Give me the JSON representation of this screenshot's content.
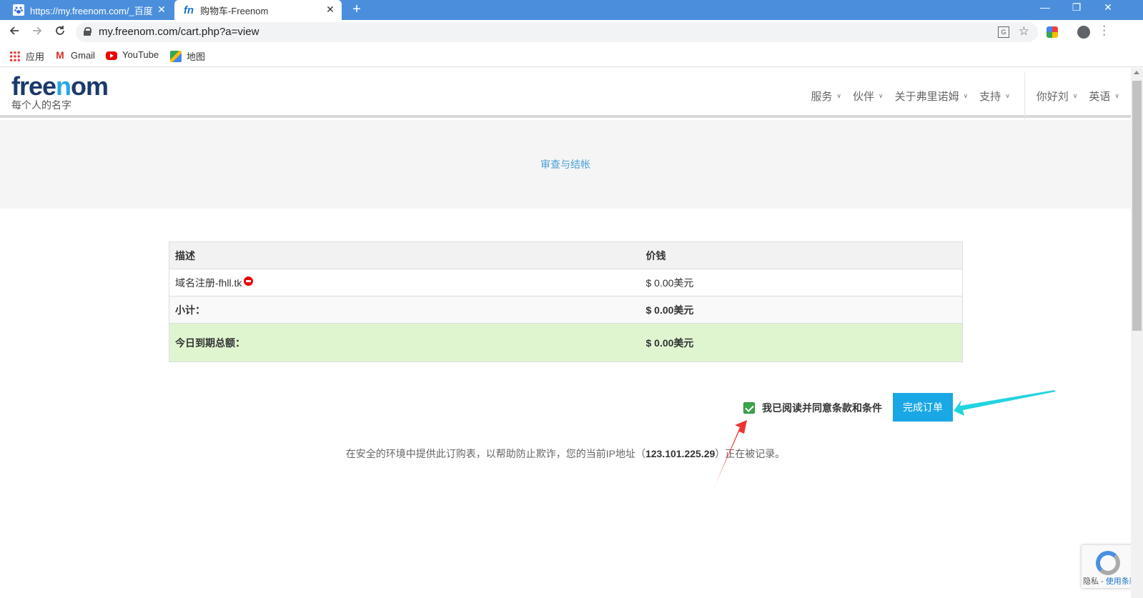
{
  "browser": {
    "tabs": [
      {
        "title": "https://my.freenom.com/_百度",
        "icon": "baidu-paw-icon",
        "active": false
      },
      {
        "title": "购物车-Freenom",
        "icon": "freenom-fn-icon",
        "fav_text": "fn",
        "active": true
      }
    ],
    "new_tab": "+",
    "close_glyph": "✕",
    "window": {
      "minimize": "—",
      "restore": "❐",
      "close": "✕"
    },
    "url": "my.freenom.com/cart.php?a=view",
    "bookmarks": [
      {
        "label": "应用",
        "icon": "apps-grid-icon"
      },
      {
        "label": "Gmail",
        "icon": "gmail-icon"
      },
      {
        "label": "YouTube",
        "icon": "youtube-icon"
      },
      {
        "label": "地图",
        "icon": "maps-icon"
      }
    ]
  },
  "site": {
    "logo": {
      "dark1": "free",
      "light": "n",
      "dark2": "om",
      "tagline": "每个人的名字"
    },
    "nav": [
      {
        "label": "服务"
      },
      {
        "label": "伙伴"
      },
      {
        "label": "关于弗里诺姆"
      },
      {
        "label": "支持"
      },
      {
        "label": "你好刘"
      },
      {
        "label": "英语"
      }
    ],
    "hero_title": "审查与结帐"
  },
  "cart": {
    "headers": {
      "description": "描述",
      "price": "价钱"
    },
    "items": [
      {
        "description": "域名注册-fhll.tk",
        "price": "$ 0.00美元"
      }
    ],
    "subtotal": {
      "label": "小计：",
      "value": "$ 0.00美元"
    },
    "total": {
      "label": "今日到期总额：",
      "value": "$ 0.00美元"
    }
  },
  "agree": {
    "label": "我已阅读并同意条款和条件",
    "checked": true
  },
  "complete_button": "完成订单",
  "notice": {
    "prefix": "在安全的环境中提供此订购表，以帮助防止欺诈，您的当前IP地址（",
    "ip": "123.101.225.29",
    "suffix": "）正在被记录。"
  },
  "recaptcha": {
    "privacy": "隐私",
    "dash": " - ",
    "terms": "使用条款"
  },
  "colors": {
    "tabstrip": "#4b8fdc",
    "accent": "#1aa7e6",
    "logo_dark": "#1b3a6b",
    "logo_light": "#27a7e8",
    "total_row_bg": "#dff5d0",
    "checkbox": "#3aa64a",
    "annotation_red": "#ee3333",
    "annotation_cyan": "#22d3e0"
  }
}
